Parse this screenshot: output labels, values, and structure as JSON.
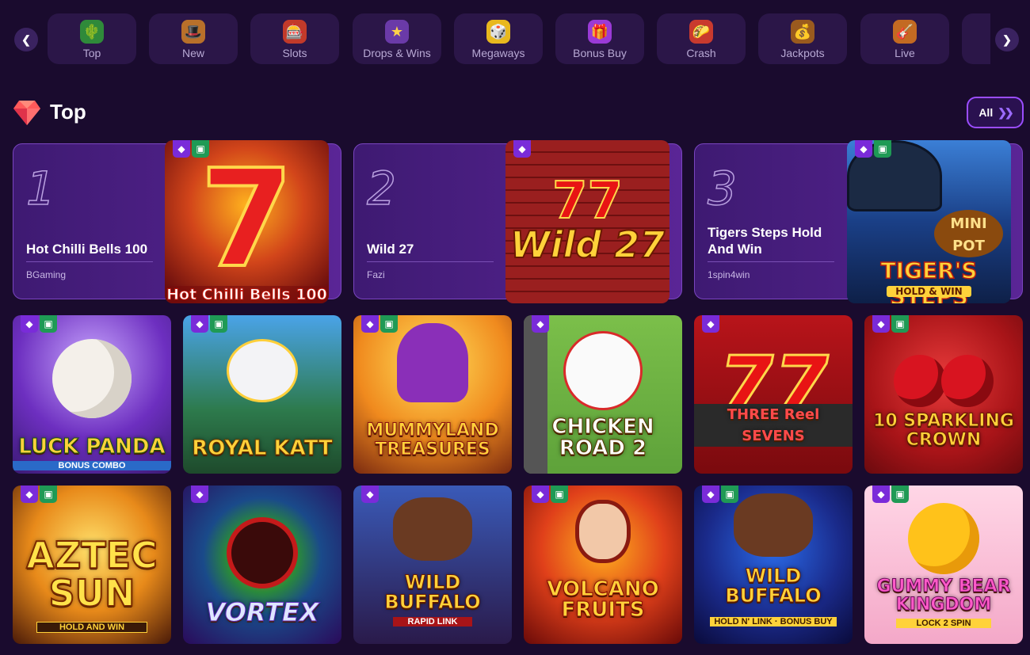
{
  "categories": [
    {
      "label": "Top",
      "icon": "cactus-icon",
      "glyph": "🌵"
    },
    {
      "label": "New",
      "icon": "sombrero-icon",
      "glyph": "🎩"
    },
    {
      "label": "Slots",
      "icon": "slot-machine-icon",
      "glyph": "🎰"
    },
    {
      "label": "Drops & Wins",
      "icon": "drops-wins-icon",
      "glyph": "★"
    },
    {
      "label": "Megaways",
      "icon": "dice-icon",
      "glyph": "🎲"
    },
    {
      "label": "Bonus Buy",
      "icon": "gift-box-icon",
      "glyph": "🎁"
    },
    {
      "label": "Crash",
      "icon": "crash-icon",
      "glyph": "🌮"
    },
    {
      "label": "Jackpots",
      "icon": "treasure-chest-icon",
      "glyph": "💰"
    },
    {
      "label": "Live",
      "icon": "guitar-icon",
      "glyph": "🎸"
    }
  ],
  "section": {
    "title": "Top",
    "all_label": "All"
  },
  "top_games": [
    {
      "rank": "1",
      "name": "Hot Chilli Bells 100",
      "provider": "BGaming",
      "thumb_title": "Hot Chilli Bells 100"
    },
    {
      "rank": "2",
      "name": "Wild 27",
      "provider": "Fazi",
      "thumb_title": "Wild 27"
    },
    {
      "rank": "3",
      "name": "Tigers Steps Hold And Win",
      "provider": "1spin4win",
      "thumb_title": "TIGER'S STEPS",
      "thumb_sub": "HOLD & WIN",
      "thumb_badge": "MINI POT"
    }
  ],
  "grid_games": [
    {
      "title": "LUCK PANDA",
      "sub": "BONUS COMBO"
    },
    {
      "title": "ROYAL KATT",
      "sub": ""
    },
    {
      "title": "MUMMYLAND TREASURES",
      "sub": ""
    },
    {
      "title": "CHICKEN ROAD 2",
      "sub": ""
    },
    {
      "title": "THREE Reel SEVENS",
      "sub": ""
    },
    {
      "title": "10 SPARKLING CROWN",
      "sub": ""
    },
    {
      "title": "AZTEC SUN",
      "sub": "HOLD AND WIN"
    },
    {
      "title": "VORTEX",
      "sub": ""
    },
    {
      "title": "WILD BUFFALO",
      "sub": "RAPID LINK"
    },
    {
      "title": "VOLCANO FRUITS",
      "sub": ""
    },
    {
      "title": "WILD BUFFALO",
      "sub": "HOLD N' LINK · BONUS BUY"
    },
    {
      "title": "GUMMY BEAR KINGDOM",
      "sub": "LOCK 2 SPIN"
    }
  ],
  "colors": {
    "background": "#1a0b2e",
    "accent": "#9b4dff",
    "gem_badge": "#7a2bd9",
    "gift_badge": "#1f9a55"
  }
}
